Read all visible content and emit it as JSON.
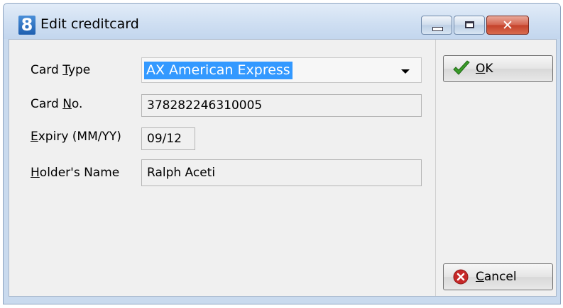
{
  "window": {
    "title": "Edit creditcard",
    "app_icon_glyph": "8",
    "close_glyph": "✕"
  },
  "form": {
    "card_type": {
      "label_pre": "Card ",
      "label_mnemonic": "T",
      "label_post": "ype",
      "value": "AX   American Express"
    },
    "card_no": {
      "label_pre": "Card ",
      "label_mnemonic": "N",
      "label_post": "o.",
      "value": "378282246310005"
    },
    "expiry": {
      "label_pre": "",
      "label_mnemonic": "E",
      "label_post": "xpiry (MM/YY)",
      "value": "09/12"
    },
    "holder": {
      "label_pre": "",
      "label_mnemonic": "H",
      "label_post": "older's Name",
      "value": "Ralph Aceti"
    }
  },
  "buttons": {
    "ok": {
      "mnemonic": "O",
      "rest": "K",
      "icon": "checkmark-icon"
    },
    "cancel": {
      "mnemonic": "C",
      "rest": "ancel",
      "icon": "cancel-icon"
    }
  },
  "colors": {
    "selection": "#3399ff",
    "ok_green": "#3a9b2a",
    "cancel_red": "#c62828"
  }
}
